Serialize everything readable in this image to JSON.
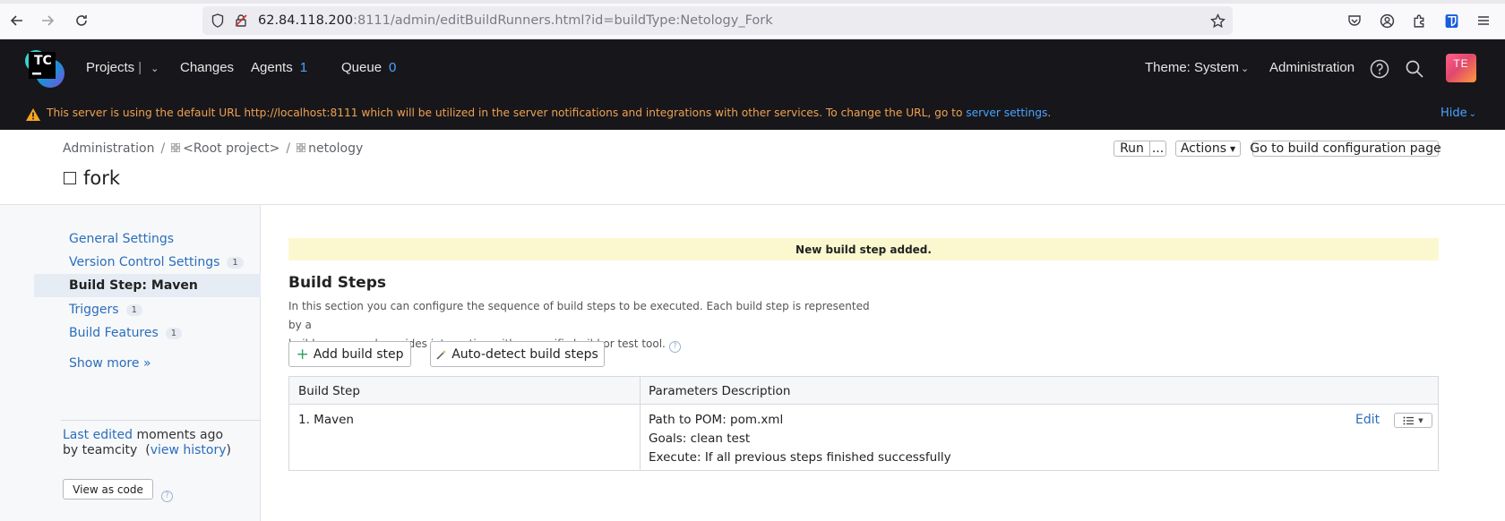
{
  "browser": {
    "url_host": "62.84.118.200",
    "url_rest": ":8111/admin/editBuildRunners.html?id=buildType:Netology_Fork"
  },
  "header": {
    "logo_text": "TC",
    "nav": {
      "projects": "Projects",
      "changes": "Changes",
      "agents": "Agents",
      "agents_count": "1",
      "queue": "Queue",
      "queue_count": "0"
    },
    "theme": "Theme: System",
    "administration": "Administration",
    "avatar_initials": "TE"
  },
  "warning": {
    "text": "This server is using the default URL http://localhost:8111 which will be utilized in the server notifications and integrations with other services. To change the URL, go to ",
    "link": "server settings",
    "suffix": ".",
    "hide": "Hide"
  },
  "breadcrumb": {
    "items": [
      "Administration",
      "<Root project>",
      "netology"
    ]
  },
  "page": {
    "title": "fork"
  },
  "toolbar": {
    "run": "Run",
    "run_more": "...",
    "actions": "Actions",
    "goto_config": "Go to build configuration page"
  },
  "sidebar": {
    "items": [
      {
        "label": "General Settings",
        "badge": ""
      },
      {
        "label": "Version Control Settings",
        "badge": "1"
      },
      {
        "label": "Build Step: Maven",
        "badge": ""
      },
      {
        "label": "Triggers",
        "badge": "1"
      },
      {
        "label": "Build Features",
        "badge": "1"
      }
    ],
    "show_more": "Show more »",
    "last_edited_link": "Last edited",
    "last_edited_when": " moments ago",
    "by_user": "by teamcity",
    "view_history": "view history",
    "view_as_code": "View as code"
  },
  "main": {
    "notice": "New build step added.",
    "section_title": "Build Steps",
    "section_desc_1": "In this section you can configure the sequence of build steps to be executed. Each build step is represented by a",
    "section_desc_2": "build runner and provides integration with a specific build or test tool.",
    "add_step": "Add build step",
    "auto_detect": "Auto-detect build steps",
    "table": {
      "headers": [
        "Build Step",
        "Parameters Description"
      ],
      "rows": [
        {
          "step": "1. Maven",
          "params": [
            "Path to POM: pom.xml",
            "Goals: clean test",
            "Execute: If all previous steps finished successfully"
          ],
          "edit": "Edit"
        }
      ]
    }
  },
  "colors": {
    "header_bg": "#17171b",
    "link_blue": "#2a6ebb",
    "accent_blue": "#4aa4ff",
    "warning_orange": "#f0a050",
    "notice_bg": "#fbf8cf"
  }
}
